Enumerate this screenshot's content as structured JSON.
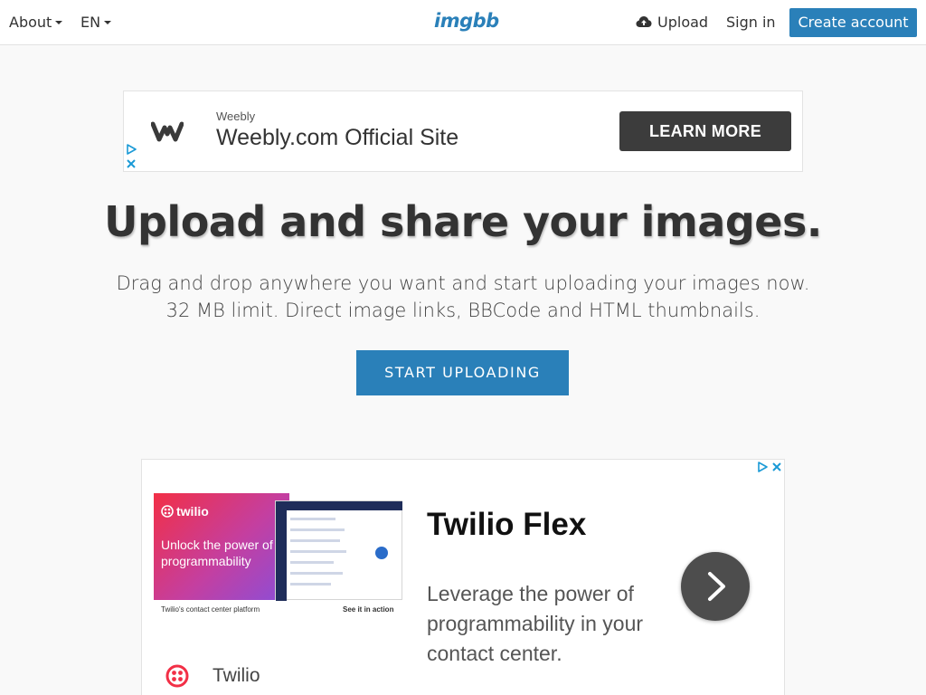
{
  "header": {
    "about_label": "About",
    "lang_label": "EN",
    "logo_text": "imgbb",
    "upload_label": "Upload",
    "signin_label": "Sign in",
    "create_account_label": "Create account",
    "brand_color": "#2a80b9"
  },
  "ad_top": {
    "sponsor": "Weebly",
    "title": "Weebly.com Official Site",
    "button_label": "LEARN MORE",
    "logo_icon": "weebly-w-icon"
  },
  "hero": {
    "title": "Upload and share your images.",
    "description": "Drag and drop anywhere you want and start uploading your images now. 32 MB limit. Direct image links, BBCode and HTML thumbnails.",
    "start_button_label": "START UPLOADING"
  },
  "ad_bottom": {
    "image_brand": "twilio",
    "image_tagline": "Unlock the power of programmability",
    "image_caption": "Twilio's contact center platform",
    "image_cta": "See it in action",
    "headline": "Twilio Flex",
    "body": "Leverage the power of programmability in your contact center.",
    "advertiser": "Twilio",
    "accent_color": "#f22f46"
  }
}
